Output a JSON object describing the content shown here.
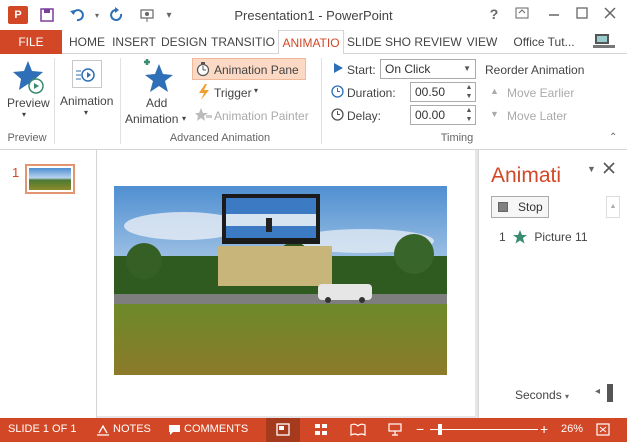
{
  "window": {
    "title": "Presentation1 - PowerPoint",
    "help_icon": "?",
    "app_logo": "P"
  },
  "tabs": {
    "file": "FILE",
    "items": [
      "HOME",
      "INSERT",
      "DESIGN",
      "TRANSITIO",
      "ANIMATIO",
      "SLIDE SHO",
      "REVIEW",
      "VIEW",
      "Office Tut..."
    ],
    "active": "ANIMATIO"
  },
  "ribbon": {
    "preview": {
      "label": "Preview",
      "group": "Preview"
    },
    "animation": {
      "label": "Animation"
    },
    "add_animation": {
      "label_line1": "Add",
      "label_line2": "Animation"
    },
    "animation_pane": {
      "label": "Animation Pane"
    },
    "trigger": {
      "label": "Trigger"
    },
    "animation_painter": {
      "label": "Animation Painter"
    },
    "advanced_group": "Advanced Animation",
    "start": {
      "label": "Start:",
      "value": "On Click"
    },
    "duration": {
      "label": "Duration:",
      "value": "00.50"
    },
    "delay": {
      "label": "Delay:",
      "value": "00.00"
    },
    "timing_group": "Timing",
    "reorder": {
      "title": "Reorder Animation",
      "earlier": "Move Earlier",
      "later": "Move Later"
    }
  },
  "slides": {
    "number": "1"
  },
  "animation_pane": {
    "title": "Animati",
    "stop_label": "Stop",
    "items": [
      {
        "order": "1",
        "label": "Picture 11"
      }
    ],
    "seconds_label": "Seconds"
  },
  "statusbar": {
    "slide_info": "SLIDE 1 OF 1",
    "notes": "NOTES",
    "comments": "COMMENTS",
    "zoom": "26%"
  },
  "colors": {
    "accent": "#d24726",
    "accent_light": "#fcd9c4",
    "star_green": "#3a8c6e"
  }
}
